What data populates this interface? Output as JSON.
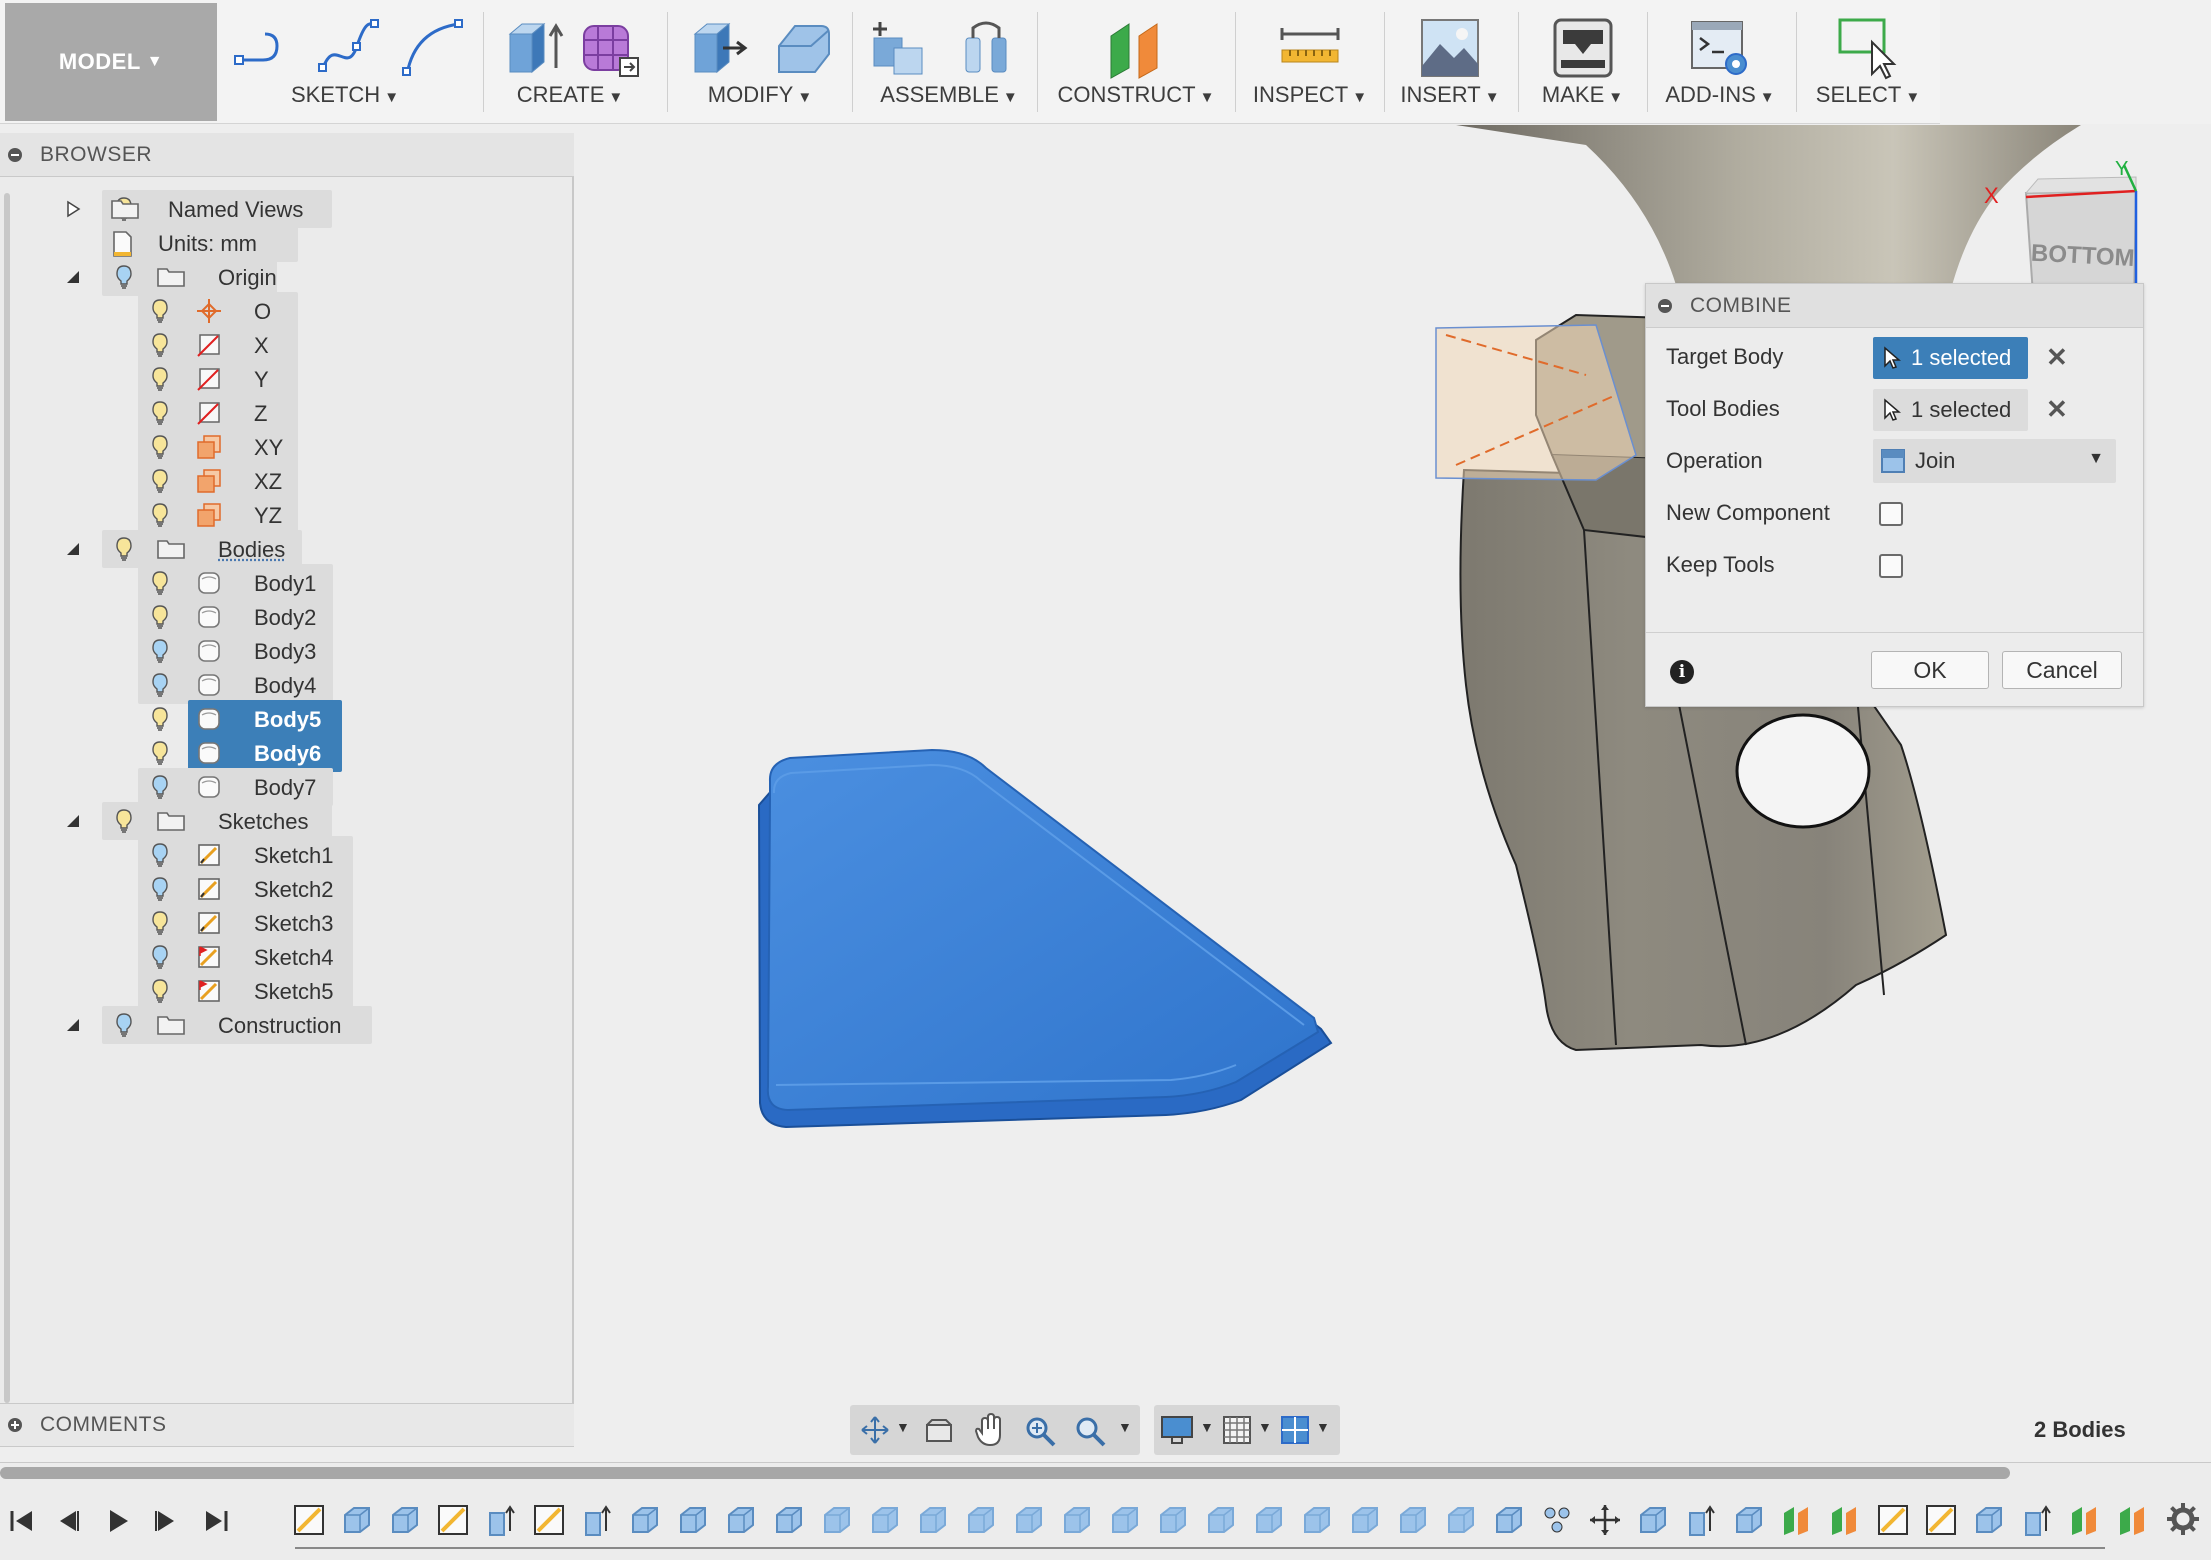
{
  "toolbar": {
    "workspace": "MODEL",
    "groups": [
      {
        "label": "SKETCH"
      },
      {
        "label": "CREATE"
      },
      {
        "label": "MODIFY"
      },
      {
        "label": "ASSEMBLE"
      },
      {
        "label": "CONSTRUCT"
      },
      {
        "label": "INSPECT"
      },
      {
        "label": "INSERT"
      },
      {
        "label": "MAKE"
      },
      {
        "label": "ADD-INS"
      },
      {
        "label": "SELECT"
      }
    ]
  },
  "viewcube": {
    "face": "BOTTOM",
    "x_axis": "X",
    "y_axis": "Y",
    "z_axis": "Z"
  },
  "browser": {
    "title": "BROWSER",
    "items": [
      {
        "label": "Named Views"
      },
      {
        "label": "Units: mm"
      },
      {
        "label": "Origin"
      },
      {
        "label": "O"
      },
      {
        "label": "X"
      },
      {
        "label": "Y"
      },
      {
        "label": "Z"
      },
      {
        "label": "XY"
      },
      {
        "label": "XZ"
      },
      {
        "label": "YZ"
      },
      {
        "label": "Bodies"
      },
      {
        "label": "Body1"
      },
      {
        "label": "Body2"
      },
      {
        "label": "Body3"
      },
      {
        "label": "Body4"
      },
      {
        "label": "Body5"
      },
      {
        "label": "Body6"
      },
      {
        "label": "Body7"
      },
      {
        "label": "Sketches"
      },
      {
        "label": "Sketch1"
      },
      {
        "label": "Sketch2"
      },
      {
        "label": "Sketch3"
      },
      {
        "label": "Sketch4"
      },
      {
        "label": "Sketch5"
      },
      {
        "label": "Construction"
      }
    ]
  },
  "comments": {
    "title": "COMMENTS"
  },
  "combine": {
    "title": "COMBINE",
    "target_body_label": "Target Body",
    "target_body_value": "1 selected",
    "tool_bodies_label": "Tool Bodies",
    "tool_bodies_value": "1 selected",
    "operation_label": "Operation",
    "operation_value": "Join",
    "new_component_label": "New Component",
    "new_component_checked": false,
    "keep_tools_label": "Keep Tools",
    "keep_tools_checked": false,
    "ok_label": "OK",
    "cancel_label": "Cancel"
  },
  "status": {
    "bodies_count": "2 Bodies"
  },
  "colors": {
    "selection_blue": "#3c7fb8",
    "body_blue": "#3a7fd4",
    "metal": "#8f8b80"
  }
}
